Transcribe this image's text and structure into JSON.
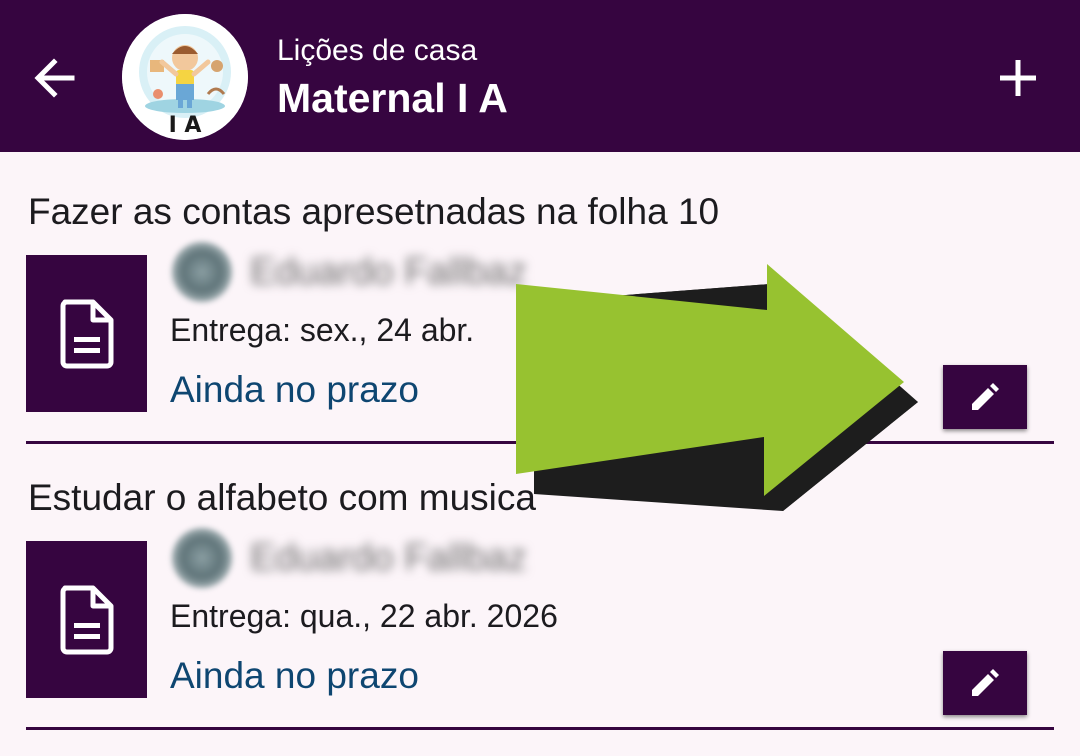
{
  "appbar": {
    "subtitle": "Lições de casa",
    "title": "Maternal I A",
    "avatar_badge": "I A",
    "back_icon": "arrow-back-icon",
    "add_icon": "plus-icon"
  },
  "tasks": [
    {
      "title": "Fazer as contas apresetnadas na folha 10",
      "person_name": "Eduardo Fallbaz",
      "due": "Entrega: sex., 24 abr.",
      "status": "Ainda no prazo",
      "file_icon": "document-icon",
      "edit_icon": "pencil-icon"
    },
    {
      "title": "Estudar o alfabeto com musica",
      "person_name": "Eduardo Fallbaz",
      "due": "Entrega: qua., 22 abr. 2026",
      "status": "Ainda no prazo",
      "file_icon": "document-icon",
      "edit_icon": "pencil-icon"
    }
  ],
  "colors": {
    "primary": "#360540",
    "background": "#fcf5f9",
    "status_text": "#0e4671",
    "annotation_arrow": "#97c230"
  }
}
